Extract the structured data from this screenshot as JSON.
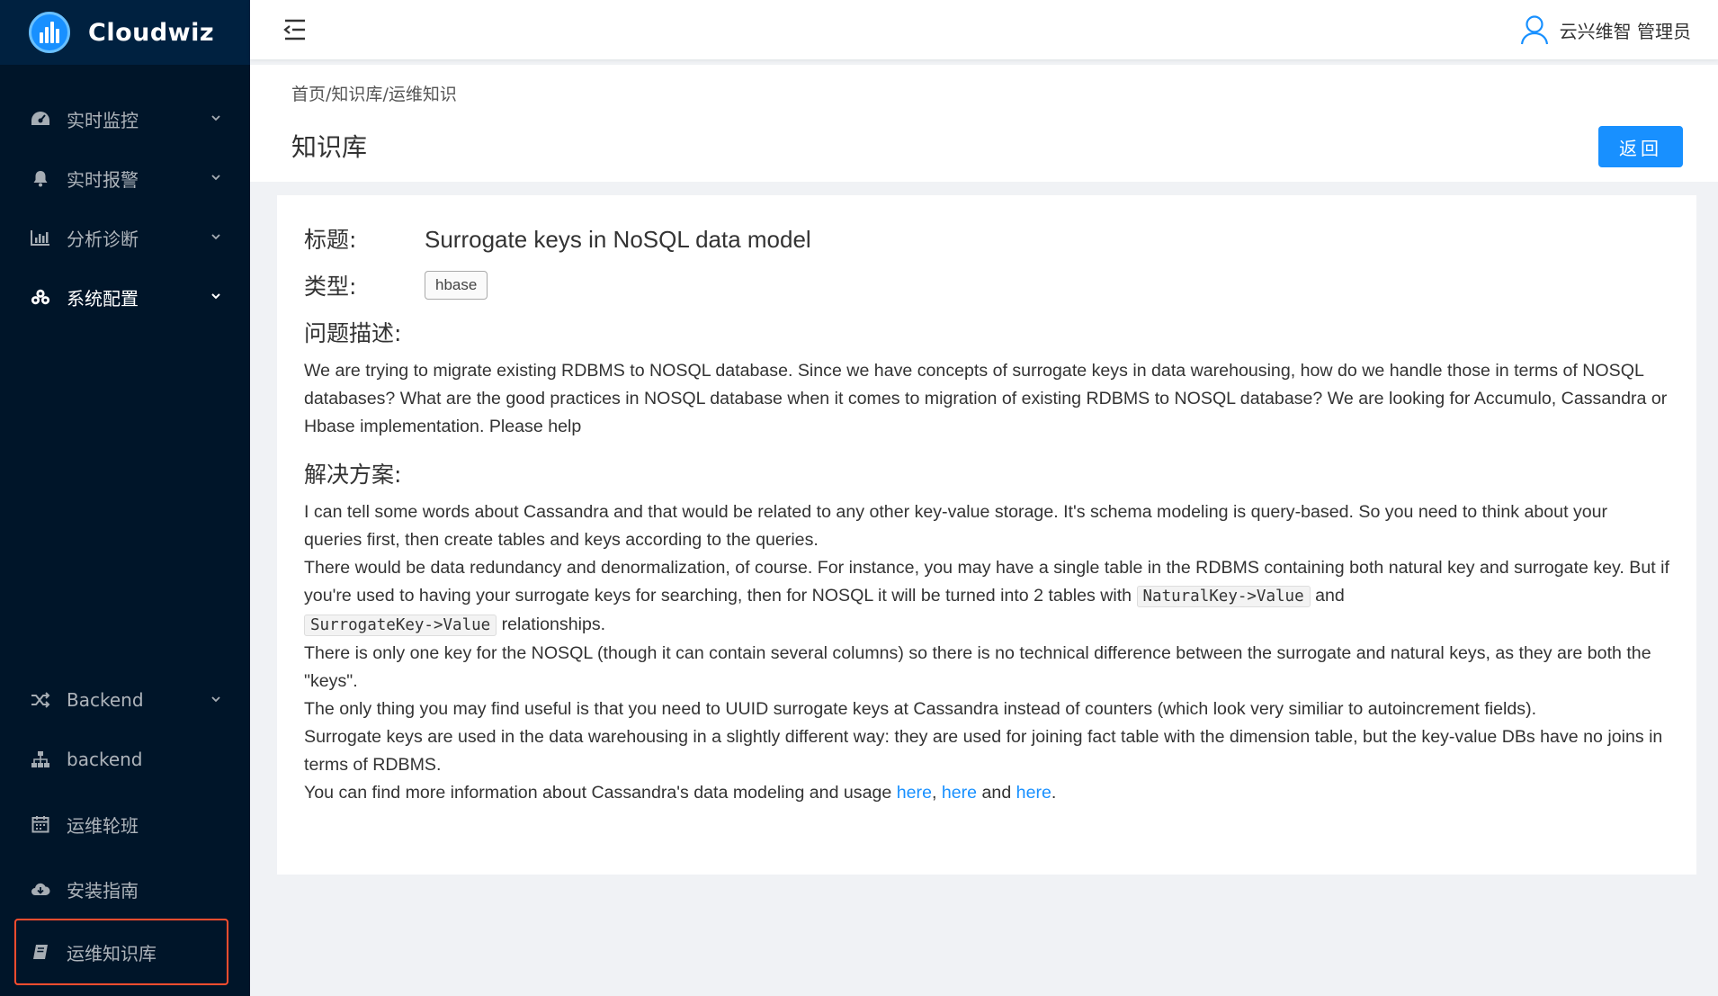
{
  "app": {
    "name": "Cloudwiz"
  },
  "sidebar": {
    "items": [
      {
        "label": "实时监控",
        "icon": "dashboard-icon"
      },
      {
        "label": "实时报警",
        "icon": "bell-icon"
      },
      {
        "label": "分析诊断",
        "icon": "bar-chart-icon"
      },
      {
        "label": "系统配置",
        "icon": "cubes-icon"
      },
      {
        "label": "Backend",
        "icon": "shuffle-icon"
      },
      {
        "label": "backend",
        "icon": "sitemap-icon"
      },
      {
        "label": "运维轮班",
        "icon": "calendar-icon"
      },
      {
        "label": "安装指南",
        "icon": "cloud-download-icon"
      },
      {
        "label": "运维知识库",
        "icon": "book-icon"
      }
    ]
  },
  "header": {
    "user_label": "云兴维智 管理员"
  },
  "breadcrumb": {
    "home": "首页",
    "kb": "知识库",
    "current": "运维知识",
    "sep": "/"
  },
  "page": {
    "title": "知识库",
    "back_label": "返回"
  },
  "article": {
    "title_label": "标题:",
    "title": "Surrogate keys in NoSQL data model",
    "type_label": "类型:",
    "type": "hbase",
    "problem_label": "问题描述:",
    "problem": "We are trying to migrate existing RDBMS to NOSQL database. Since we have concepts of surrogate keys in data warehousing, how do we handle those in terms of NOSQL databases? What are the good practices in NOSQL database when it comes to migration of existing RDBMS to NOSQL database? We are looking for Accumulo, Cassandra or Hbase implementation. Please help",
    "solution_label": "解决方案:",
    "solution": {
      "p1": "I can tell some words about Cassandra and that would be related to any other key-value storage. It's schema modeling is query-based. So you need to think about your queries first, then create tables and keys according to the queries.",
      "p2a": "There would be data redundancy and denormalization, of course. For instance, you may have a single table in the RDBMS containing both natural key and surrogate key. But if you're used to having your surrogate keys for searching, then for NOSQL it will be turned into 2 tables with ",
      "code1": "NaturalKey->Value",
      "p2b": " and ",
      "code2": "SurrogateKey->Value",
      "p2c": " relationships.",
      "p3": "There is only one key for the NOSQL (though it can contain several columns) so there is no technical difference between the surrogate and natural keys, as they are both the \"keys\".",
      "p4": "The only thing you may find useful is that you need to UUID surrogate keys at Cassandra instead of counters (which look very similiar to autoincrement fields).",
      "p5": "Surrogate keys are used in the data warehousing in a slightly different way: they are used for joining fact table with the dimension table, but the key-value DBs have no joins in terms of RDBMS.",
      "p6a": "You can find more information about Cassandra's data modeling and usage ",
      "link1": "here",
      "comma": ", ",
      "link2": "here",
      "and": " and ",
      "link3": "here",
      "period": "."
    }
  },
  "colors": {
    "sidebar_bg": "#001529",
    "accent": "#1890ff",
    "highlight_border": "#ff4d2e"
  }
}
